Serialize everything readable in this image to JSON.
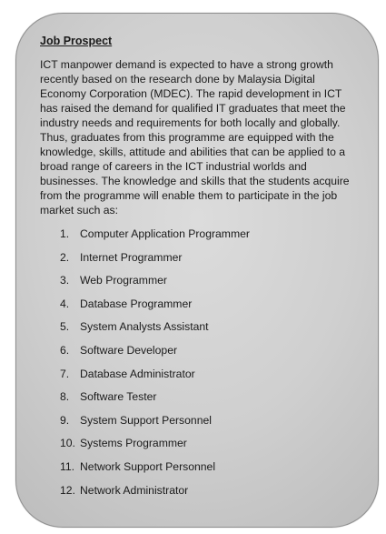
{
  "document": {
    "title": "Job Prospect",
    "paragraph": "ICT manpower demand is expected to have a strong growth recently based on the research done by Malaysia Digital Economy Corporation (MDEC). The rapid development in ICT has raised the demand for qualified IT graduates that meet the industry needs and requirements for both locally and globally. Thus, graduates from this programme are equipped with the knowledge, skills, attitude and abilities that can be applied to a broad range of careers in the ICT industrial worlds and businesses. The knowledge and skills that the students acquire from the programme will enable them to participate in the job market such as:",
    "items": [
      {
        "num": "1.",
        "label": "Computer Application Programmer"
      },
      {
        "num": "2.",
        "label": "Internet Programmer"
      },
      {
        "num": "3.",
        "label": "Web Programmer"
      },
      {
        "num": "4.",
        "label": "Database Programmer"
      },
      {
        "num": "5.",
        "label": "System Analysts Assistant"
      },
      {
        "num": "6.",
        "label": "Software Developer"
      },
      {
        "num": "7.",
        "label": "Database Administrator"
      },
      {
        "num": "8.",
        "label": "Software Tester"
      },
      {
        "num": "9.",
        "label": "System Support Personnel"
      },
      {
        "num": "10.",
        "label": "Systems Programmer"
      },
      {
        "num": "11.",
        "label": "Network Support Personnel"
      },
      {
        "num": "12.",
        "label": "Network Administrator"
      }
    ]
  }
}
